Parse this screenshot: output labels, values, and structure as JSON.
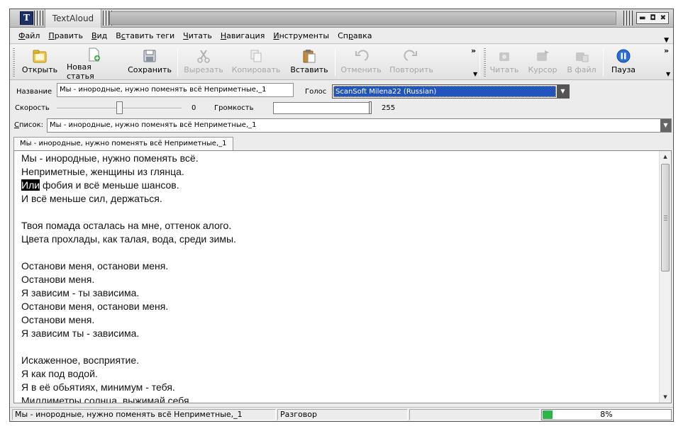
{
  "window": {
    "title": "TextAloud"
  },
  "menu": [
    {
      "pre": "",
      "u": "Ф",
      "post": "айл"
    },
    {
      "pre": "",
      "u": "П",
      "post": "равить"
    },
    {
      "pre": "",
      "u": "В",
      "post": "ид"
    },
    {
      "pre": "В",
      "u": "с",
      "post": "тавить теги"
    },
    {
      "pre": "",
      "u": "Ч",
      "post": "итать"
    },
    {
      "pre": "",
      "u": "Н",
      "post": "авигация"
    },
    {
      "pre": "",
      "u": "И",
      "post": "нструменты"
    },
    {
      "pre": "Сп",
      "u": "р",
      "post": "авка"
    }
  ],
  "toolbar": {
    "open": "Открыть",
    "new_article": "Новая статья",
    "save": "Сохранить",
    "cut": "Вырезать",
    "copy": "Копировать",
    "paste": "Вставить",
    "undo": "Отменить",
    "redo": "Повторить",
    "read": "Читать",
    "cursor": "Курсор",
    "to_file": "В файл",
    "pause": "Пауза"
  },
  "form": {
    "name_label": "Название",
    "name_value": "Мы - инородные, нужно поменять всё Неприметные,_1",
    "voice_label": "Голос",
    "voice_value": "ScanSoft Milena22 (Russian)",
    "speed_label": "Скорость",
    "speed_value": "0",
    "volume_label": "Громкость",
    "volume_value": "255",
    "list_label_u": "С",
    "list_label_rest": "писок:",
    "list_value": "Мы - инородные, нужно поменять всё Неприметные,_1",
    "speed_position": 0.5,
    "volume_level": 1.0
  },
  "doc_tab": "Мы - инородные, нужно поменять всё Неприметные,_1",
  "editor": {
    "highlight_word": "Или",
    "lines": [
      "Мы - инородные, нужно поменять всё.",
      "Неприметные, женщины из глянца.",
      "Или фобия и всё меньше шансов.",
      "И всё меньше сил, держаться.",
      "",
      "Твоя помада осталась на мне, оттенок алого.",
      "Цвета прохлады, как талая, вода, среди зимы.",
      "",
      "Останови меня, останови меня.",
      "Останови меня.",
      "Я зависим - ты зависима.",
      "Останови меня, останови меня.",
      "Останови меня.",
      "Я зависим ты - зависима.",
      "",
      "Искаженное, восприятие.",
      "Я как под водой.",
      "Я в её обьятиях, минимум - тебя.",
      "Миллиметры солнца, выжимай себя."
    ]
  },
  "status": {
    "doc": "Мы - инородные, нужно поменять всё Неприметные,_1",
    "mode": "Разговор",
    "progress_percent": 8,
    "progress_label": "8%"
  }
}
